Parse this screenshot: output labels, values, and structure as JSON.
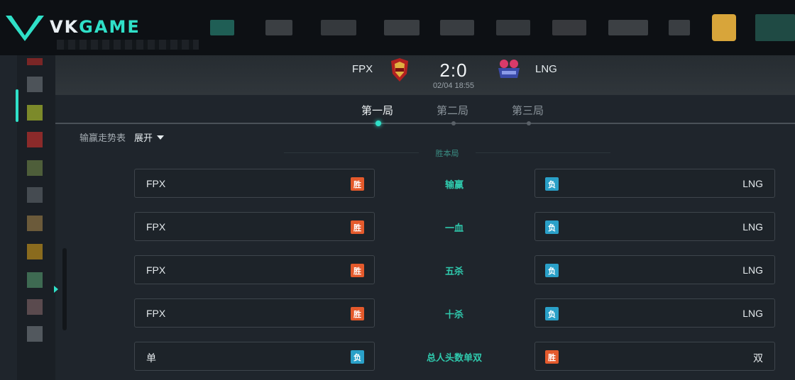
{
  "brand": {
    "logo_text_a": "VK",
    "logo_text_b": "GAME",
    "accent": "#2fe0c8"
  },
  "match": {
    "team_left": "FPX",
    "team_right": "LNG",
    "score": "2:0",
    "date": "02/04 18:55"
  },
  "tabs": [
    {
      "label": "第一局",
      "active": true
    },
    {
      "label": "第二局",
      "active": false
    },
    {
      "label": "第三局",
      "active": false
    }
  ],
  "trend": {
    "label": "输赢走势表",
    "expand_label": "展开"
  },
  "section": {
    "title": "胜本局"
  },
  "bets": [
    {
      "title": "输赢",
      "left": {
        "name": "FPX",
        "badge": "胜",
        "badge_color": "orange"
      },
      "right": {
        "name": "LNG",
        "badge": "负",
        "badge_color": "blue"
      }
    },
    {
      "title": "一血",
      "left": {
        "name": "FPX",
        "badge": "胜",
        "badge_color": "orange"
      },
      "right": {
        "name": "LNG",
        "badge": "负",
        "badge_color": "blue"
      }
    },
    {
      "title": "五杀",
      "left": {
        "name": "FPX",
        "badge": "胜",
        "badge_color": "orange"
      },
      "right": {
        "name": "LNG",
        "badge": "负",
        "badge_color": "blue"
      }
    },
    {
      "title": "十杀",
      "left": {
        "name": "FPX",
        "badge": "胜",
        "badge_color": "orange"
      },
      "right": {
        "name": "LNG",
        "badge": "负",
        "badge_color": "blue"
      }
    },
    {
      "title": "总人头数单双",
      "left": {
        "name": "单",
        "badge": "负",
        "badge_color": "blue"
      },
      "right": {
        "name": "双",
        "badge": "胜",
        "badge_color": "orange"
      }
    }
  ]
}
